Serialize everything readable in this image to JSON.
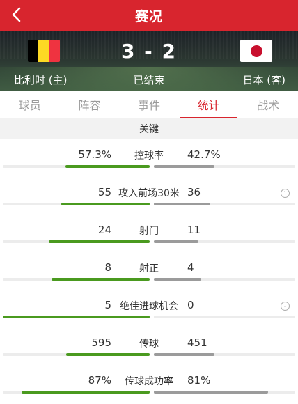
{
  "header": {
    "title": "赛况",
    "back_icon": "chevron-left-icon"
  },
  "match": {
    "home_team": "比利时 (主)",
    "away_team": "日本 (客)",
    "score": "3 - 2",
    "status": "已结束",
    "home_flag_colors": [
      "#000000",
      "#FDDA24",
      "#EF3340"
    ],
    "away_flag_colors": [
      "#FFFFFF",
      "#C8102E"
    ]
  },
  "tabs": [
    {
      "label": "球员",
      "active": false
    },
    {
      "label": "阵容",
      "active": false
    },
    {
      "label": "事件",
      "active": false
    },
    {
      "label": "统计",
      "active": true
    },
    {
      "label": "战术",
      "active": false
    }
  ],
  "section_title": "关键",
  "colors": {
    "accent": "#d8252e",
    "home_bar": "#4a9a1f",
    "away_bar": "#9b9b9b"
  },
  "stats": [
    {
      "label": "控球率",
      "home": "57.3%",
      "away": "42.7%",
      "home_share": 0.573,
      "away_share": 0.427,
      "info": false
    },
    {
      "label": "攻入前场30米",
      "home": "55",
      "away": "36",
      "home_share": 0.6,
      "away_share": 0.4,
      "info": true
    },
    {
      "label": "射门",
      "home": "24",
      "away": "11",
      "home_share": 0.686,
      "away_share": 0.314,
      "info": false
    },
    {
      "label": "射正",
      "home": "8",
      "away": "4",
      "home_share": 0.667,
      "away_share": 0.333,
      "info": false
    },
    {
      "label": "绝佳进球机会",
      "home": "5",
      "away": "0",
      "home_share": 1.0,
      "away_share": 0.0,
      "info": true
    },
    {
      "label": "传球",
      "home": "595",
      "away": "451",
      "home_share": 0.569,
      "away_share": 0.431,
      "info": false
    },
    {
      "label": "传球成功率",
      "home": "87%",
      "away": "81%",
      "home_share": 0.87,
      "away_share": 0.81,
      "info": false
    }
  ]
}
